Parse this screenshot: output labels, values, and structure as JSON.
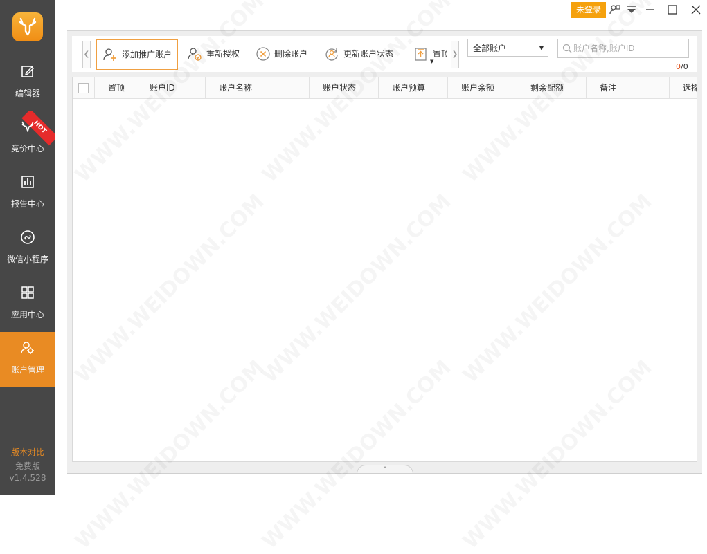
{
  "sidebar": {
    "items": [
      {
        "label": "编辑器",
        "icon": "edit-icon"
      },
      {
        "label": "竞价中心",
        "icon": "deer-icon",
        "badge": "HOT"
      },
      {
        "label": "报告中心",
        "icon": "report-chart-icon"
      },
      {
        "label": "微信小程序",
        "icon": "mini-program-icon"
      },
      {
        "label": "应用中心",
        "icon": "apps-grid-icon"
      },
      {
        "label": "账户管理",
        "icon": "account-settings-icon",
        "active": true
      }
    ],
    "version_compare": "版本对比",
    "edition": "免费版",
    "version": "v1.4.528"
  },
  "titlebar": {
    "login_label": "未登录"
  },
  "toolbar": {
    "buttons": [
      {
        "label": "添加推广账户",
        "icon": "add-user-icon"
      },
      {
        "label": "重新授权",
        "icon": "reauthorize-icon"
      },
      {
        "label": "删除账户",
        "icon": "delete-circle-icon"
      },
      {
        "label": "更新账户状态",
        "icon": "refresh-user-icon"
      },
      {
        "label": "置顶",
        "icon": "pin-top-icon"
      }
    ],
    "filter_select": "全部账户",
    "search_placeholder": "账户名称,账户ID",
    "selected_count": "0",
    "total_count": "0"
  },
  "table": {
    "columns": [
      "置顶",
      "账户ID",
      "账户名称",
      "账户状态",
      "账户预算",
      "账户余额",
      "剩余配额",
      "备注",
      "选择"
    ],
    "rows": []
  },
  "colors": {
    "sidebar_bg": "#474747",
    "accent": "#e98b23",
    "login_bg": "#f5a10d",
    "hot_badge": "#e62b2b"
  },
  "watermark": "WWW.WEIDOWN.COM"
}
